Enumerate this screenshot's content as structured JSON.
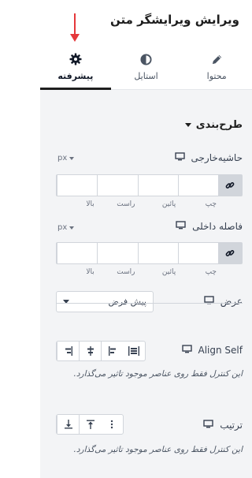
{
  "header": {
    "title": "ویرایش ویرایشگر متن"
  },
  "tabs": [
    {
      "label": "محتوا",
      "icon": "pencil-icon",
      "active": false
    },
    {
      "label": "استایل",
      "icon": "contrast-icon",
      "active": false
    },
    {
      "label": "پیشرفته",
      "icon": "gear-icon",
      "active": true
    }
  ],
  "section": {
    "title": "طرح‌بندی"
  },
  "margin": {
    "label": "حاشیه‌خارجی",
    "unit": "px",
    "sides": [
      "بالا",
      "راست",
      "پائین",
      "چپ"
    ]
  },
  "padding": {
    "label": "فاصله داخلی",
    "unit": "px",
    "sides": [
      "بالا",
      "راست",
      "پائین",
      "چپ"
    ]
  },
  "width": {
    "label": "عرض",
    "value": "پیش فرض"
  },
  "align_self": {
    "label": "Align Self",
    "help": "این کنترل فقط روی عناصر موجود تاثیر می‌گذارد."
  },
  "order": {
    "label": "ترتیب",
    "help": "این کنترل فقط روی عناصر موجود تاثیر می‌گذارد."
  },
  "colors": {
    "accent_arrow": "#e5383b",
    "panel_bg": "#f3f4f6",
    "active_tab": "#1e1e1e"
  }
}
